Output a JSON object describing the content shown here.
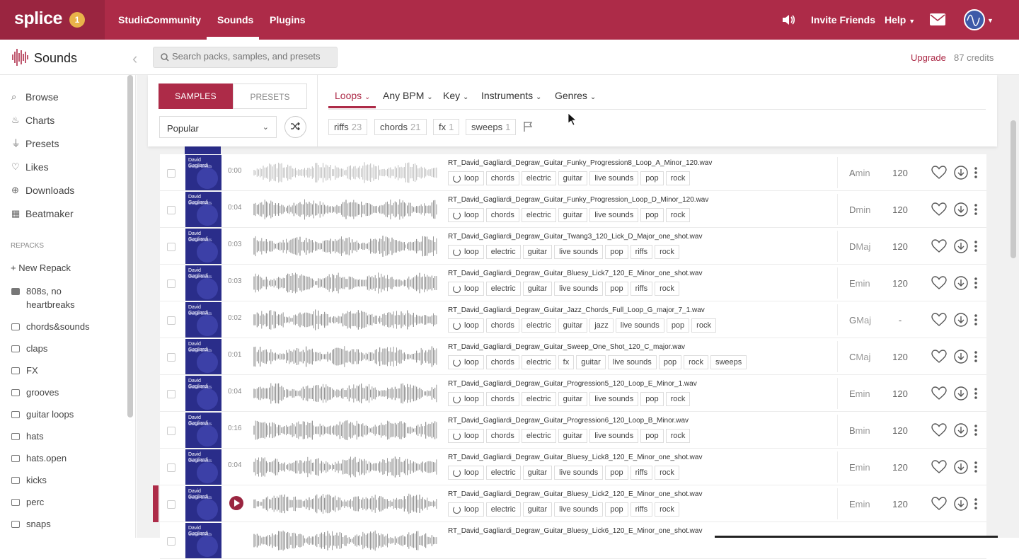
{
  "nav": {
    "logo": "splice",
    "badge": "1",
    "items": [
      "Studio",
      "Community",
      "Sounds",
      "Plugins"
    ],
    "invite": "Invite Friends",
    "help": "Help"
  },
  "subheader": {
    "title": "Sounds",
    "search_placeholder": "Search packs, samples, and presets",
    "upgrade": "Upgrade",
    "credits": "87 credits"
  },
  "sidebar": {
    "items": [
      "Browse",
      "Charts",
      "Presets",
      "Likes",
      "Downloads",
      "Beatmaker"
    ],
    "repacks_label": "REPACKS",
    "new_repack": "+ New Repack",
    "folders": [
      "808s, no",
      "heartbreaks",
      "chords&sounds",
      "claps",
      "FX",
      "grooves",
      "guitar loops",
      "hats",
      "hats.open",
      "kicks",
      "perc",
      "snaps"
    ]
  },
  "filters": {
    "tab_samples": "SAMPLES",
    "tab_presets": "PRESETS",
    "sort": "Popular",
    "dropdowns": [
      "Loops",
      "Any BPM",
      "Key",
      "Instruments",
      "Genres"
    ],
    "chips": [
      {
        "label": "riffs",
        "count": "23"
      },
      {
        "label": "chords",
        "count": "21"
      },
      {
        "label": "fx",
        "count": "1"
      },
      {
        "label": "sweeps",
        "count": "1"
      }
    ]
  },
  "pack": {
    "title": "David Gagliardi",
    "subtitle": "Guitar Beats"
  },
  "rows": [
    {
      "dur": "0:00",
      "file": "RT_David_Gagliardi_Degraw_Guitar_Funky_Progression8_Loop_A_Minor_120.wav",
      "tags": [
        "chords",
        "electric",
        "guitar",
        "live sounds",
        "pop",
        "rock"
      ],
      "key1": "A",
      "key2": "min",
      "bpm": "120",
      "seed": 3
    },
    {
      "dur": "0:04",
      "file": "RT_David_Gagliardi_Degraw_Guitar_Funky_Progression_Loop_D_Minor_120.wav",
      "tags": [
        "chords",
        "electric",
        "guitar",
        "live sounds",
        "pop",
        "rock"
      ],
      "key1": "D",
      "key2": "min",
      "bpm": "120",
      "seed": 7
    },
    {
      "dur": "0:03",
      "file": "RT_David_Gagliardi_Degraw_Guitar_Twang3_120_Lick_D_Major_one_shot.wav",
      "tags": [
        "electric",
        "guitar",
        "live sounds",
        "pop",
        "riffs",
        "rock"
      ],
      "key1": "D",
      "key2": "Maj",
      "bpm": "120",
      "seed": 11
    },
    {
      "dur": "0:03",
      "file": "RT_David_Gagliardi_Degraw_Guitar_Bluesy_Lick7_120_E_Minor_one_shot.wav",
      "tags": [
        "electric",
        "guitar",
        "live sounds",
        "pop",
        "riffs",
        "rock"
      ],
      "key1": "E",
      "key2": "min",
      "bpm": "120",
      "seed": 5
    },
    {
      "dur": "0:02",
      "file": "RT_David_Gagliardi_Degraw_Guitar_Jazz_Chords_Full_Loop_G_major_7_1.wav",
      "tags": [
        "chords",
        "electric",
        "guitar",
        "jazz",
        "live sounds",
        "pop",
        "rock"
      ],
      "key1": "G",
      "key2": "Maj",
      "bpm": "-",
      "seed": 13
    },
    {
      "dur": "0:01",
      "file": "RT_David_Gagliardi_Degraw_Guitar_Sweep_One_Shot_120_C_major.wav",
      "tags": [
        "chords",
        "electric",
        "fx",
        "guitar",
        "live sounds",
        "pop",
        "rock",
        "sweeps"
      ],
      "key1": "C",
      "key2": "Maj",
      "bpm": "120",
      "seed": 17
    },
    {
      "dur": "0:04",
      "file": "RT_David_Gagliardi_Degraw_Guitar_Progression5_120_Loop_E_Minor_1.wav",
      "tags": [
        "chords",
        "electric",
        "guitar",
        "live sounds",
        "pop",
        "rock"
      ],
      "key1": "E",
      "key2": "min",
      "bpm": "120",
      "seed": 19
    },
    {
      "dur": "0:16",
      "file": "RT_David_Gagliardi_Degraw_Guitar_Progression6_120_Loop_B_Minor.wav",
      "tags": [
        "chords",
        "electric",
        "guitar",
        "live sounds",
        "pop",
        "rock"
      ],
      "key1": "B",
      "key2": "min",
      "bpm": "120",
      "seed": 23
    },
    {
      "dur": "0:04",
      "file": "RT_David_Gagliardi_Degraw_Guitar_Bluesy_Lick8_120_E_Minor_one_shot.wav",
      "tags": [
        "electric",
        "guitar",
        "live sounds",
        "pop",
        "riffs",
        "rock"
      ],
      "key1": "E",
      "key2": "min",
      "bpm": "120",
      "seed": 29
    },
    {
      "dur": "",
      "file": "RT_David_Gagliardi_Degraw_Guitar_Bluesy_Lick2_120_E_Minor_one_shot.wav",
      "tags": [
        "electric",
        "guitar",
        "live sounds",
        "pop",
        "riffs",
        "rock"
      ],
      "key1": "E",
      "key2": "min",
      "bpm": "120",
      "seed": 31,
      "playing": true
    },
    {
      "dur": "",
      "file": "RT_David_Gagliardi_Degraw_Guitar_Bluesy_Lick6_120_E_Minor_one_shot.wav",
      "tags": [],
      "key1": "",
      "key2": "",
      "bpm": "",
      "seed": 37
    }
  ],
  "tag_loop": "loop"
}
